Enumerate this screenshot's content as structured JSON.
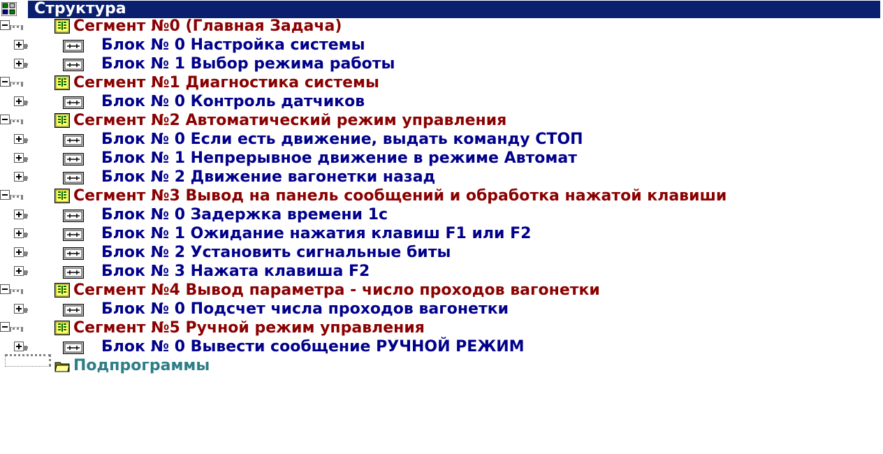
{
  "tree": {
    "root_label": "Структура",
    "subprograms_label": "Подпрограммы",
    "segments": [
      {
        "label": "Сегмент №0  (Главная Задача)",
        "blocks": [
          "Блок № 0  Настройка системы",
          "Блок № 1 Выбор режима работы"
        ]
      },
      {
        "label": "Сегмент №1  Диагностика системы",
        "blocks": [
          "Блок № 0 Контроль датчиков"
        ]
      },
      {
        "label": "Сегмент №2  Автоматический режим управления",
        "blocks": [
          "Блок № 0 Если есть движение, выдать команду СТОП",
          "Блок № 1 Непрерывное движение в режиме Автомат",
          "Блок № 2 Движение вагонетки назад"
        ]
      },
      {
        "label": "Сегмент №3  Вывод на панель сообщений и обработка нажатой клавиши",
        "blocks": [
          "Блок № 0  Задержка времени 1с",
          "Блок № 1 Ожидание нажатия клавиш  F1 или F2",
          "Блок № 2 Установить сигнальные биты",
          "Блок № 3 Нажата клавиша F2"
        ]
      },
      {
        "label": "Сегмент №4  Вывод параметра - число проходов вагонетки",
        "blocks": [
          "Блок № 0  Подсчет числа проходов вагонетки"
        ]
      },
      {
        "label": "Сегмент №5  Ручной режим управления",
        "blocks": [
          "Блок № 0 Вывести сообщение РУЧНОЙ РЕЖИМ"
        ]
      }
    ],
    "colors": {
      "selection": "#0a1f6e",
      "segment_text": "#8b0000",
      "block_text": "#00008b",
      "subprograms_text": "#2e7d87"
    },
    "icons": {
      "root": "structure-icon",
      "segment": "segment-icon",
      "block": "block-icon",
      "subprograms": "folder-icon",
      "expand": "plus-box-icon",
      "collapse": "minus-box-icon"
    }
  }
}
